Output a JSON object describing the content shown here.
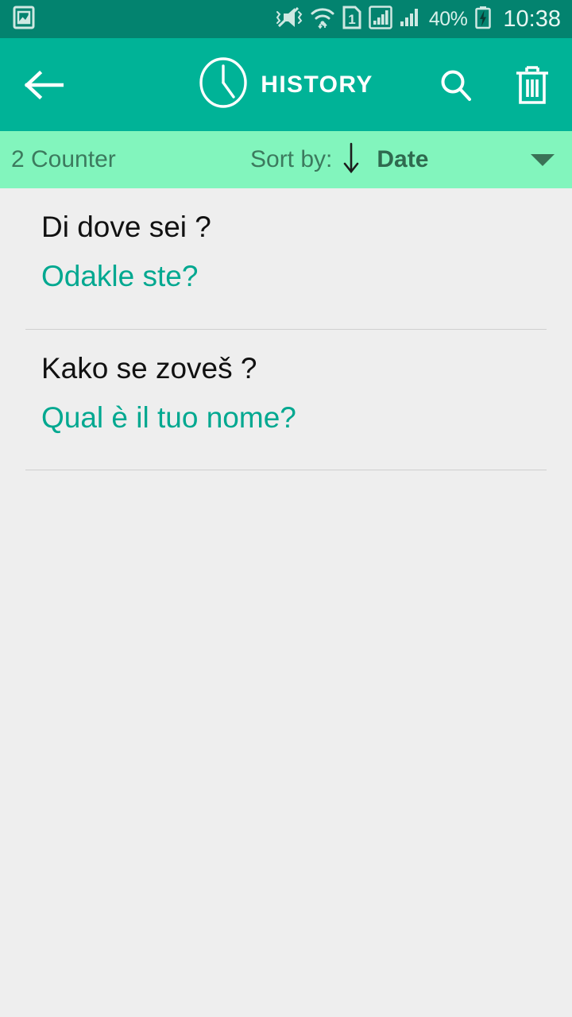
{
  "status_bar": {
    "notification_icon": "photo-gallery-icon",
    "icons": [
      "vibrate-mute-icon",
      "wifi-icon",
      "sim-1-icon",
      "signal-sim1-icon",
      "signal-sim2-icon"
    ],
    "battery_percent": "40%",
    "battery_icon": "battery-charging-icon",
    "time": "10:38",
    "background_color": "#03836f"
  },
  "app_bar": {
    "back_label": "back-arrow",
    "clock_icon": "clock-icon",
    "title": "HISTORY",
    "search_label": "search-icon",
    "delete_label": "delete-icon",
    "background_color": "#00b397"
  },
  "sort_bar": {
    "counter": "2 Counter",
    "sort_by_label": "Sort by:",
    "sort_direction_icon": "arrow-down-icon",
    "sort_value": "Date",
    "dropdown_icon": "caret-down-icon",
    "background_color": "#82f5bd"
  },
  "history": {
    "items": [
      {
        "source": "Di dove sei ?",
        "target": "Odakle ste?"
      },
      {
        "source": "Kako se zoveš ?",
        "target": "Qual è il tuo nome?"
      }
    ]
  },
  "colors": {
    "accent": "#00a890",
    "page_background": "#eeeeee",
    "divider": "#cfcfcf"
  }
}
